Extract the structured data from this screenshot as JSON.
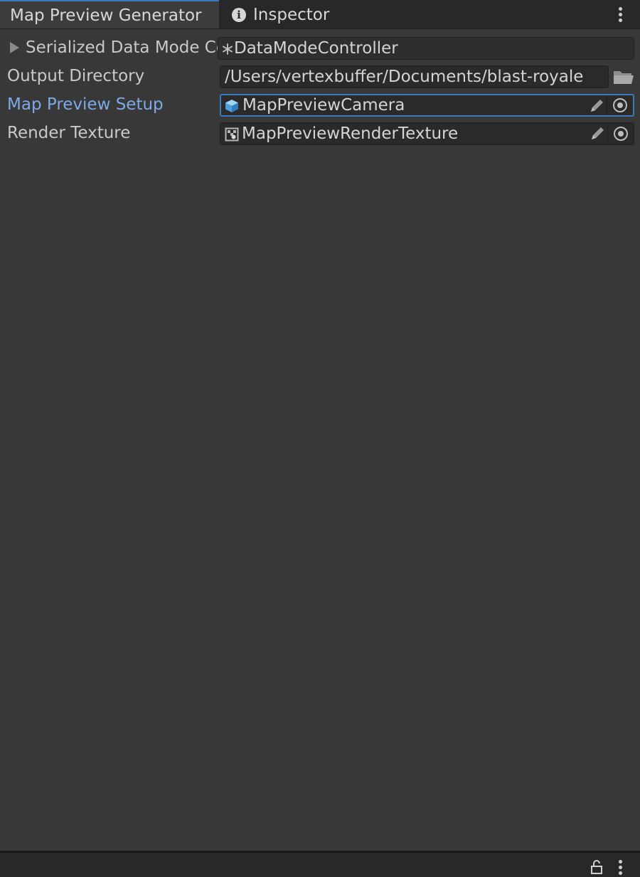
{
  "tabs": [
    {
      "label": "Map Preview Generator",
      "active": true
    },
    {
      "label": "Inspector",
      "active": false,
      "icon": "info-icon"
    }
  ],
  "fields": {
    "serialized_data_mode": {
      "label": "Serialized Data Mode Co",
      "value": "DataModeController",
      "icon": "script-icon"
    },
    "output_directory": {
      "label": "Output Directory",
      "value": "/Users/vertexbuffer/Documents/blast-royale",
      "icon": "folder-icon"
    },
    "map_preview_setup": {
      "label": "Map Preview Setup",
      "value": "MapPreviewCamera",
      "icon": "prefab-cube-icon"
    },
    "render_texture": {
      "label": "Render Texture",
      "value": "MapPreviewRenderTexture",
      "icon": "render-texture-icon"
    }
  },
  "colors": {
    "background": "#383838",
    "tab_bar": "#282828",
    "accent": "#3a79bb",
    "focused_label": "#7ea9e6",
    "field_bg": "#2a2a2a"
  }
}
